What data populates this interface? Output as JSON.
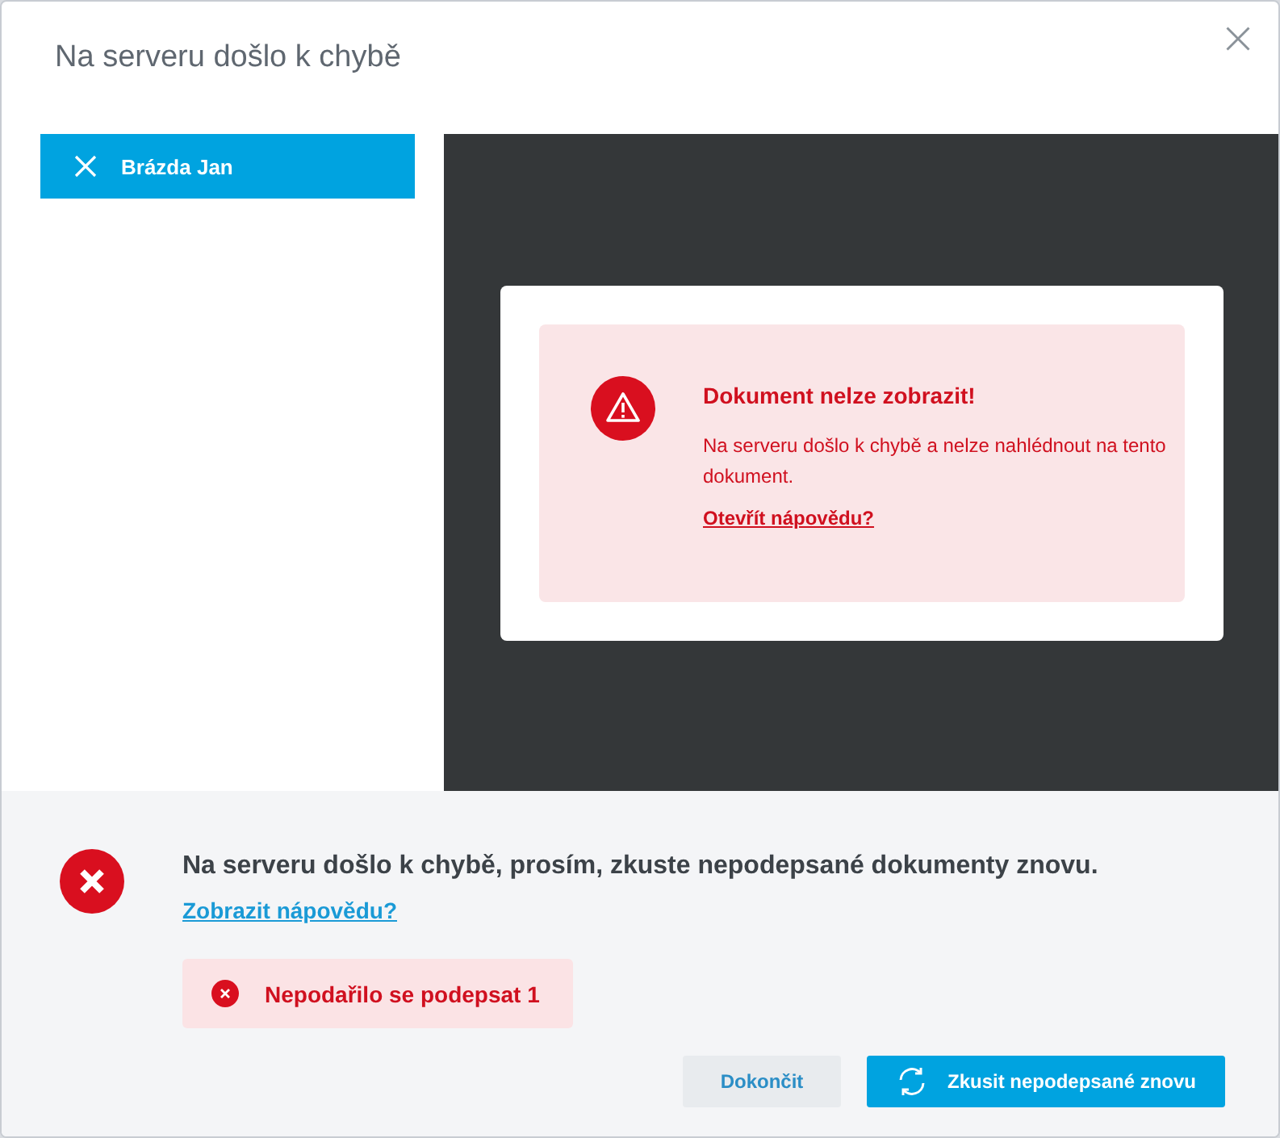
{
  "dialog": {
    "title": "Na serveru došlo k chybě"
  },
  "signers": [
    {
      "name": "Brázda Jan",
      "selected": true
    }
  ],
  "viewer": {
    "error_title": "Dokument nelze zobrazit!",
    "error_text": "Na serveru došlo k chybě a nelze nahlédnout na tento dokument.",
    "help_link": "Otevřít nápovědu?"
  },
  "footer": {
    "message": "Na serveru došlo k chybě, prosím, zkuste nepodepsané dokumenty znovu.",
    "help_link": "Zobrazit nápovědu?",
    "failures": [
      "Nepodařilo se podepsat 1"
    ],
    "buttons": [
      {
        "label": "Dokončit",
        "kind": "secondary"
      },
      {
        "label": "Zkusit nepodepsané znovu",
        "kind": "primary"
      }
    ]
  }
}
